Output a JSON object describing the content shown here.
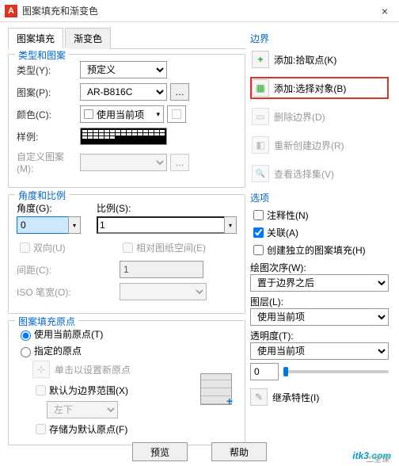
{
  "dialog": {
    "title": "图案填充和渐变色"
  },
  "tabs": {
    "hatch": "图案填充",
    "gradient": "渐变色"
  },
  "type_pattern": {
    "group": "类型和图案",
    "type_label": "类型(Y):",
    "type_value": "预定义",
    "pattern_label": "图案(P):",
    "pattern_value": "AR-B816C",
    "color_label": "颜色(C):",
    "color_value": "使用当前项",
    "sample_label": "样例:",
    "custom_label": "自定义图案(M):"
  },
  "angle_scale": {
    "group": "角度和比例",
    "angle_label": "角度(G):",
    "angle_value": "0",
    "scale_label": "比例(S):",
    "scale_value": "1",
    "double_label": "双向(U)",
    "paperspace_label": "相对图纸空间(E)",
    "spacing_label": "间距(C):",
    "spacing_value": "1",
    "iso_label": "ISO 笔宽(O):"
  },
  "origin": {
    "group": "图案填充原点",
    "use_current": "使用当前原点(T)",
    "specified": "指定的原点",
    "click_set": "单击以设置新原点",
    "default_extent": "默认为边界范围(X)",
    "extent_value": "左下",
    "store_default": "存储为默认原点(F)"
  },
  "boundary": {
    "title": "边界",
    "add_pick": "添加:拾取点(K)",
    "add_select": "添加:选择对象(B)",
    "delete": "删除边界(D)",
    "rebuild": "重新创建边界(R)",
    "view_sel": "查看选择集(V)"
  },
  "options": {
    "title": "选项",
    "annotative": "注释性(N)",
    "associative": "关联(A)",
    "independent": "创建独立的图案填充(H)",
    "draw_order_label": "绘图次序(W):",
    "draw_order_value": "置于边界之后",
    "layer_label": "图层(L):",
    "layer_value": "使用当前项",
    "transparency_label": "透明度(T):",
    "transparency_select": "使用当前项",
    "transparency_value": "0",
    "inherit": "继承特性(I)"
  },
  "footer": {
    "preview": "预览",
    "help": "帮助"
  },
  "watermark": {
    "main": "itk3",
    "tld": "com",
    "sub": "二堂课"
  }
}
